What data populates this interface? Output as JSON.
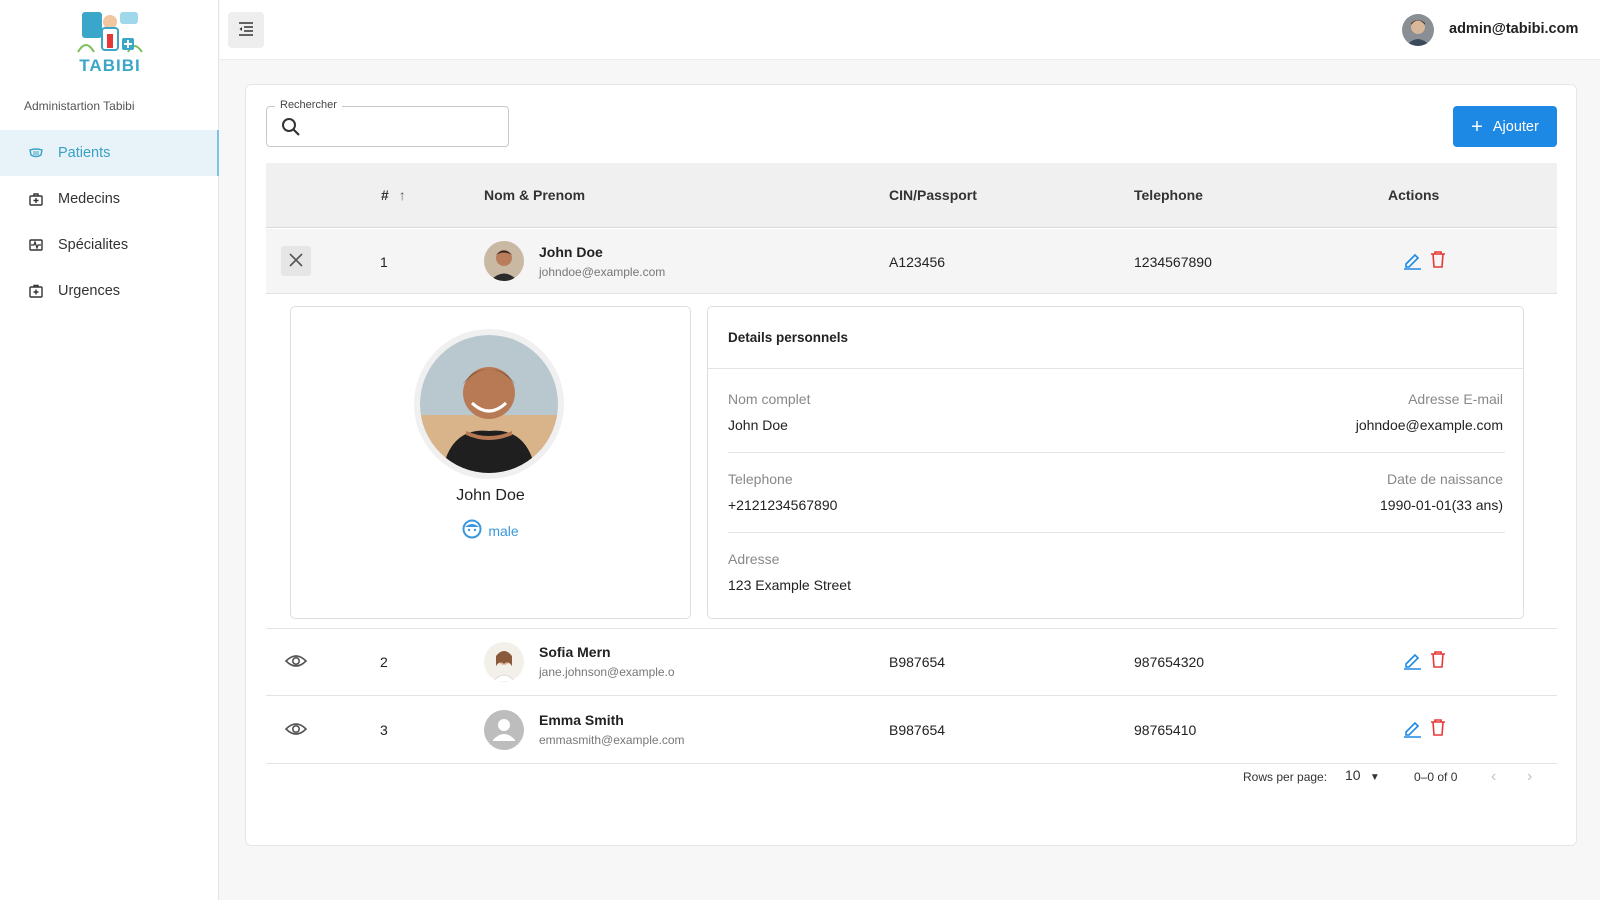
{
  "brand": {
    "name": "TABIBI",
    "subtitle": "Administartion Tabibi"
  },
  "sidebar": {
    "items": [
      {
        "label": "Patients",
        "icon": "mask-icon",
        "active": true
      },
      {
        "label": "Medecins",
        "icon": "medical-bag-icon",
        "active": false
      },
      {
        "label": "Spécialites",
        "icon": "ecg-icon",
        "active": false
      },
      {
        "label": "Urgences",
        "icon": "first-aid-kit-icon",
        "active": false
      }
    ]
  },
  "topbar": {
    "user_email": "admin@tabibi.com"
  },
  "search": {
    "legend": "Rechercher",
    "value": ""
  },
  "toolbar": {
    "add_label": "Ajouter"
  },
  "table": {
    "columns": {
      "index": "#",
      "name": "Nom & Prenom",
      "cin": "CIN/Passport",
      "phone": "Telephone",
      "actions": "Actions"
    },
    "rows": [
      {
        "index": "1",
        "name": "John Doe",
        "email": "johndoe@example.com",
        "cin": "A123456",
        "phone": "1234567890",
        "expanded": true
      },
      {
        "index": "2",
        "name": "Sofia Mern",
        "email": "jane.johnson@example.o",
        "cin": "B987654",
        "phone": "987654320",
        "expanded": false
      },
      {
        "index": "3",
        "name": "Emma Smith",
        "email": "emmasmith@example.com",
        "cin": "B987654",
        "phone": "98765410",
        "expanded": false
      }
    ]
  },
  "detail": {
    "name": "John Doe",
    "gender": "male",
    "title": "Details personnels",
    "fields": {
      "full_name_label": "Nom complet",
      "full_name": "John Doe",
      "email_label": "Adresse E-mail",
      "email": "johndoe@example.com",
      "phone_label": "Telephone",
      "phone": "+2121234567890",
      "dob_label": "Date de naissance",
      "dob": "1990-01-01(33 ans)",
      "address_label": "Adresse",
      "address": "123 Example Street"
    }
  },
  "pagination": {
    "rows_per_page_label": "Rows per page:",
    "rows_per_page": "10",
    "range": "0–0 of 0"
  },
  "colors": {
    "accent": "#1e88e5",
    "brand": "#3aa6c9",
    "danger": "#e53935"
  }
}
